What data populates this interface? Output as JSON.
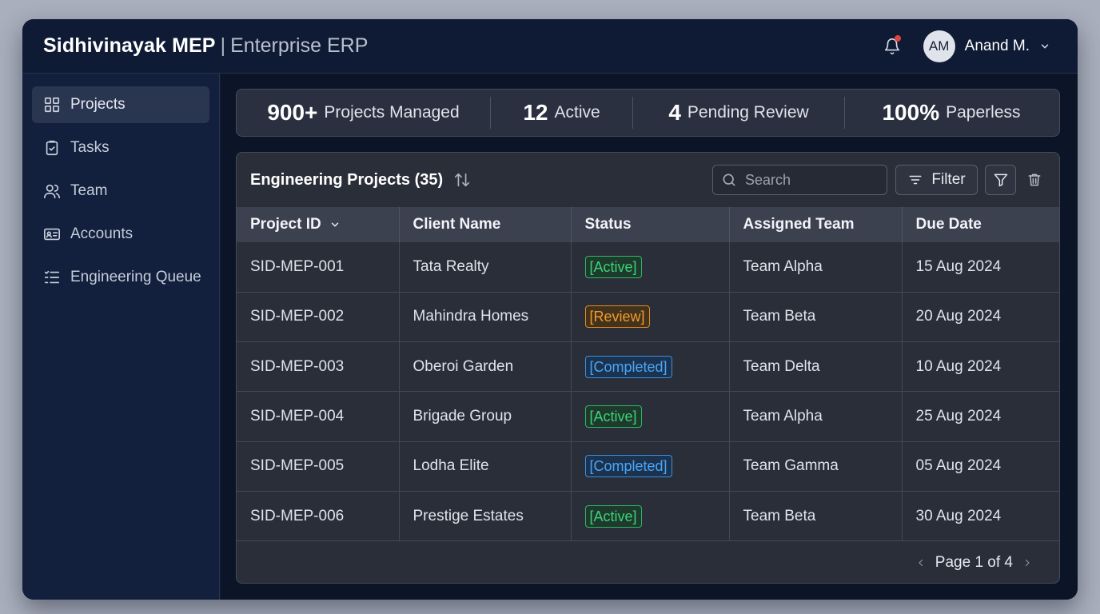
{
  "header": {
    "brand": "Sidhivinayak MEP",
    "separator": "|",
    "subtitle": "Enterprise ERP",
    "user": {
      "initials": "AM",
      "name": "Anand M."
    },
    "notification_dot_color": "#e2433b"
  },
  "sidebar": {
    "items": [
      {
        "label": "Projects",
        "icon": "grid-icon",
        "active": true
      },
      {
        "label": "Tasks",
        "icon": "clipboard-check-icon",
        "active": false
      },
      {
        "label": "Team",
        "icon": "users-icon",
        "active": false
      },
      {
        "label": "Accounts",
        "icon": "id-card-icon",
        "active": false
      },
      {
        "label": "Engineering Queue",
        "icon": "checklist-icon",
        "active": false
      }
    ]
  },
  "stats": [
    {
      "value": "900+",
      "label": "Projects Managed"
    },
    {
      "value": "12",
      "label": "Active"
    },
    {
      "value": "4",
      "label": "Pending Review"
    },
    {
      "value": "100%",
      "label": "Paperless"
    }
  ],
  "panel": {
    "title": "Engineering Projects (35)",
    "search_placeholder": "Search",
    "filter_label": "Filter"
  },
  "table": {
    "columns": [
      "Project ID",
      "Client Name",
      "Status",
      "Assigned Team",
      "Due Date"
    ],
    "rows": [
      {
        "id": "SID-MEP-001",
        "client": "Tata Realty",
        "status": "[Active]",
        "status_type": "active",
        "team": "Team Alpha",
        "due": "15 Aug 2024"
      },
      {
        "id": "SID-MEP-002",
        "client": "Mahindra Homes",
        "status": "[Review]",
        "status_type": "review",
        "team": "Team Beta",
        "due": "20 Aug 2024"
      },
      {
        "id": "SID-MEP-003",
        "client": "Oberoi Garden",
        "status": "[Completed]",
        "status_type": "completed",
        "team": "Team Delta",
        "due": "10 Aug 2024"
      },
      {
        "id": "SID-MEP-004",
        "client": "Brigade Group",
        "status": "[Active]",
        "status_type": "active",
        "team": "Team Alpha",
        "due": "25 Aug 2024"
      },
      {
        "id": "SID-MEP-005",
        "client": "Lodha Elite",
        "status": "[Completed]",
        "status_type": "completed",
        "team": "Team Gamma",
        "due": "05 Aug 2024"
      },
      {
        "id": "SID-MEP-006",
        "client": "Prestige Estates",
        "status": "[Active]",
        "status_type": "active",
        "team": "Team Beta",
        "due": "30 Aug 2024"
      }
    ]
  },
  "pagination": {
    "label": "Page 1 of 4"
  },
  "colors": {
    "active": "#3ed27a",
    "review": "#f29b2e",
    "completed": "#4aa6f5"
  }
}
